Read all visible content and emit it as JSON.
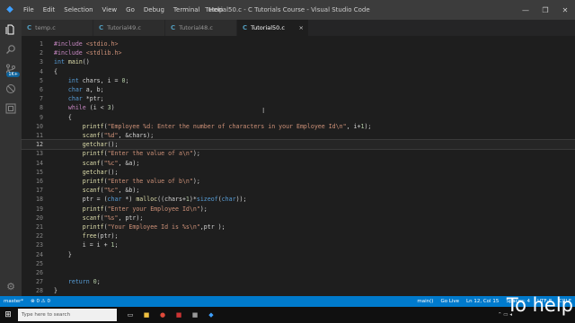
{
  "window": {
    "title": "Tutorial50.c - C Tutorials Course - Visual Studio Code"
  },
  "menu": [
    "File",
    "Edit",
    "Selection",
    "View",
    "Go",
    "Debug",
    "Terminal",
    "Help"
  ],
  "window_controls": {
    "minimize": "—",
    "restore": "❐",
    "close": "✕"
  },
  "activity_badge": "1K+",
  "tabs": [
    {
      "icon": "C",
      "label": "temp.c"
    },
    {
      "icon": "C",
      "label": "Tutorial49.c"
    },
    {
      "icon": "C",
      "label": "Tutorial48.c"
    },
    {
      "icon": "C",
      "label": "Tutorial50.c",
      "close": "×"
    }
  ],
  "code_lines": [
    {
      "n": "1",
      "code": "#include <stdio.h>"
    },
    {
      "n": "2",
      "code": "#include <stdlib.h>"
    },
    {
      "n": "3",
      "code": "int main()"
    },
    {
      "n": "4",
      "code": "{"
    },
    {
      "n": "5",
      "code": "    int chars, i = 0;"
    },
    {
      "n": "6",
      "code": "    char a, b;"
    },
    {
      "n": "7",
      "code": "    char *ptr;"
    },
    {
      "n": "8",
      "code": "    while (i < 3)"
    },
    {
      "n": "9",
      "code": "    {"
    },
    {
      "n": "10",
      "code": "        printf(\"Employee %d: Enter the number of characters in your Employee Id\\n\", i+1);"
    },
    {
      "n": "11",
      "code": "        scanf(\"%d\", &chars);"
    },
    {
      "n": "12",
      "code": "        getchar();"
    },
    {
      "n": "13",
      "code": "        printf(\"Enter the value of a\\n\");"
    },
    {
      "n": "14",
      "code": "        scanf(\"%c\", &a);"
    },
    {
      "n": "15",
      "code": "        getchar();"
    },
    {
      "n": "16",
      "code": "        printf(\"Enter the value of b\\n\");"
    },
    {
      "n": "17",
      "code": "        scanf(\"%c\", &b);"
    },
    {
      "n": "18",
      "code": "        ptr = (char *) malloc((chars+1)*sizeof(char));"
    },
    {
      "n": "19",
      "code": "        printf(\"Enter your Employee Id\\n\");"
    },
    {
      "n": "20",
      "code": "        scanf(\"%s\", ptr);"
    },
    {
      "n": "21",
      "code": "        printf(\"Your Employee Id is %s\\n\",ptr );"
    },
    {
      "n": "22",
      "code": "        free(ptr);"
    },
    {
      "n": "23",
      "code": "        i = i + 1;"
    },
    {
      "n": "24",
      "code": "    }"
    },
    {
      "n": "25",
      "code": ""
    },
    {
      "n": "26",
      "code": ""
    },
    {
      "n": "27",
      "code": "    return 0;"
    },
    {
      "n": "28",
      "code": "}"
    }
  ],
  "current_line": "12",
  "status": {
    "branch": "master*",
    "sync": "⊗ 0 ⚠ 0",
    "function": "main()",
    "golive": "Go Live",
    "position": "Ln 12, Col 15",
    "spaces": "Spaces: 4",
    "encoding": "UTF-8",
    "eol": "CRLF"
  },
  "taskbar": {
    "search_placeholder": "Type here to search"
  },
  "caption": "To help",
  "colors": {
    "accent": "#007acc",
    "keyword": "#569cd6",
    "string": "#ce9178",
    "number": "#b5cea8",
    "function": "#dcdcaa"
  }
}
